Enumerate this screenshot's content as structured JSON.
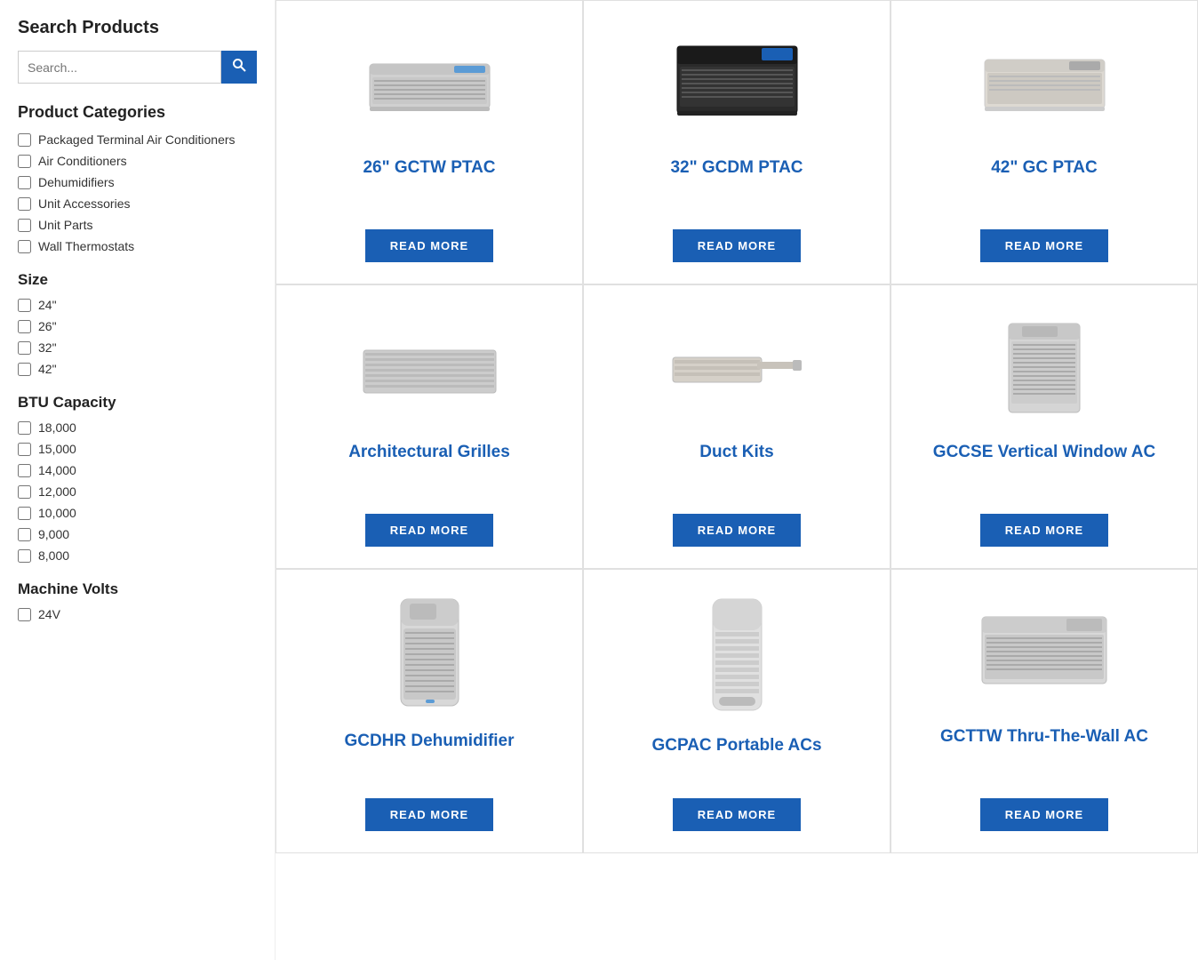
{
  "sidebar": {
    "search_products_title": "Search Products",
    "search_placeholder": "Search...",
    "product_categories_title": "Product Categories",
    "categories": [
      {
        "label": "Packaged Terminal Air Conditioners"
      },
      {
        "label": "Air Conditioners"
      },
      {
        "label": "Dehumidifiers"
      },
      {
        "label": "Unit Accessories"
      },
      {
        "label": "Unit Parts"
      },
      {
        "label": "Wall Thermostats"
      }
    ],
    "size_title": "Size",
    "sizes": [
      {
        "label": "24\""
      },
      {
        "label": "26\""
      },
      {
        "label": "32\""
      },
      {
        "label": "42\""
      }
    ],
    "btu_title": "BTU Capacity",
    "btus": [
      {
        "label": "18,000"
      },
      {
        "label": "15,000"
      },
      {
        "label": "14,000"
      },
      {
        "label": "12,000"
      },
      {
        "label": "10,000"
      },
      {
        "label": "9,000"
      },
      {
        "label": "8,000"
      }
    ],
    "volts_title": "Machine Volts",
    "volts": [
      {
        "label": "24V"
      }
    ]
  },
  "products": [
    {
      "title": "26\" GCTW PTAC",
      "read_more": "READ MORE"
    },
    {
      "title": "32\" GCDM PTAC",
      "read_more": "READ MORE"
    },
    {
      "title": "42\" GC PTAC",
      "read_more": "READ MORE"
    },
    {
      "title": "Architectural Grilles",
      "read_more": "READ MORE"
    },
    {
      "title": "Duct Kits",
      "read_more": "READ MORE"
    },
    {
      "title": "GCCSE Vertical Window AC",
      "read_more": "READ MORE"
    },
    {
      "title": "GCDHR Dehumidifier",
      "read_more": "READ MORE"
    },
    {
      "title": "GCPAC Portable ACs",
      "read_more": "READ MORE"
    },
    {
      "title": "GCTTW Thru-The-Wall AC",
      "read_more": "READ MORE"
    }
  ],
  "colors": {
    "blue": "#1a5fb4",
    "btn_blue": "#1a5fb4"
  }
}
